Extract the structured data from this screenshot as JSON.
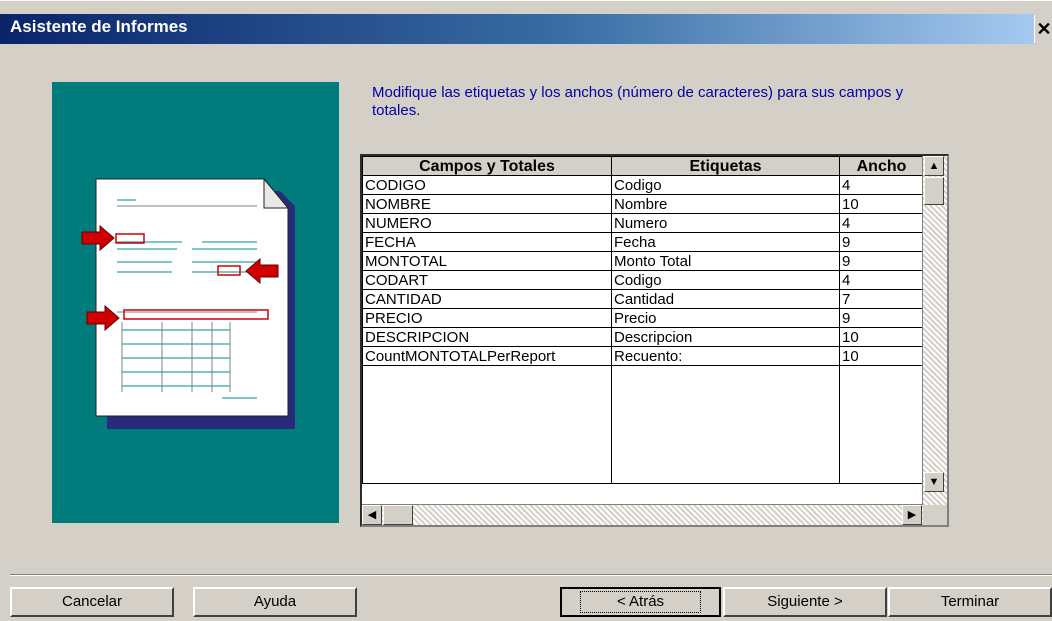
{
  "window": {
    "title": "Asistente de Informes",
    "close_glyph": "✕"
  },
  "instruction": "Modifique las etiquetas y los anchos (número de caracteres) para sus campos y totales.",
  "grid": {
    "headers": [
      "Campos y Totales",
      "Etiquetas",
      "Ancho"
    ],
    "rows": [
      [
        "CODIGO",
        "Codigo",
        "4"
      ],
      [
        "NOMBRE",
        "Nombre",
        "10"
      ],
      [
        "NUMERO",
        "Numero",
        "4"
      ],
      [
        "FECHA",
        "Fecha",
        "9"
      ],
      [
        "MONTOTAL",
        "Monto Total",
        "9"
      ],
      [
        "CODART",
        "Codigo",
        "4"
      ],
      [
        "CANTIDAD",
        "Cantidad",
        "7"
      ],
      [
        "PRECIO",
        "Precio",
        "9"
      ],
      [
        "DESCRIPCION",
        "Descripcion",
        "10"
      ],
      [
        "CountMONTOTALPerReport",
        "Recuento:",
        "10"
      ]
    ]
  },
  "buttons": {
    "cancel": "Cancelar",
    "help": "Ayuda",
    "back": "< Atrás",
    "next": "Siguiente >",
    "finish": "Terminar"
  },
  "icons": {
    "scroll_up": "up-arrow-icon",
    "scroll_down": "down-arrow-icon",
    "scroll_left": "left-arrow-icon",
    "scroll_right": "right-arrow-icon"
  },
  "colors": {
    "title_bar": "#0a246a",
    "illustration_bg": "#007c7c",
    "instruction_text": "#0000a8",
    "callout_arrow": "#cc0000"
  }
}
